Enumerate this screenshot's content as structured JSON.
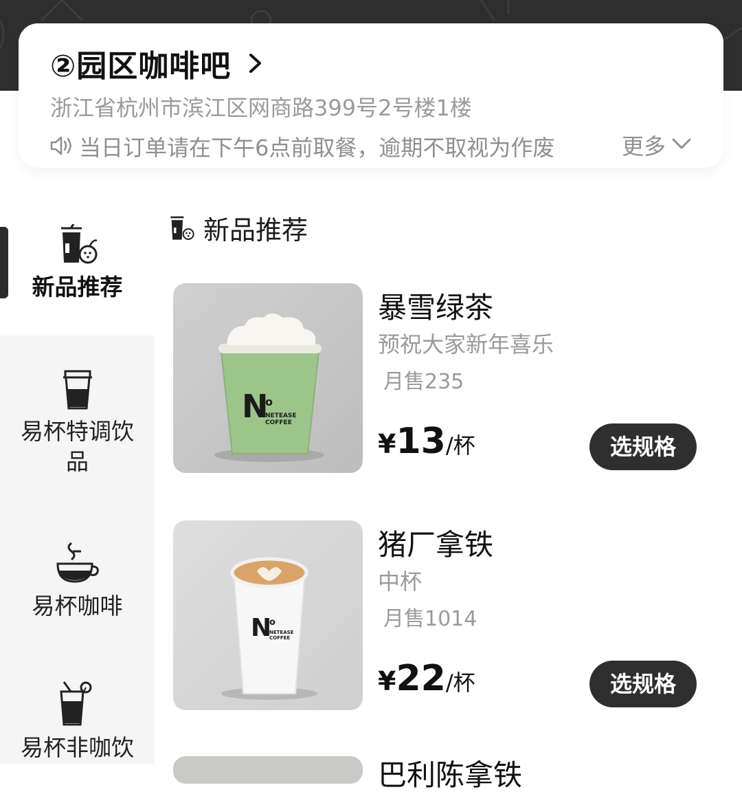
{
  "store": {
    "name": "②园区咖啡吧",
    "address": "浙江省杭州市滨江区网商路399号2号楼1楼",
    "notice": "当日订单请在下午6点前取餐，逾期不取视为作废",
    "more_label": "更多"
  },
  "sidebar": {
    "items": [
      {
        "label": "新品推荐",
        "icon": "new-drink-icon"
      },
      {
        "label": "易杯特调饮品",
        "icon": "takeaway-cup-icon"
      },
      {
        "label": "易杯咖啡",
        "icon": "hot-coffee-icon"
      },
      {
        "label": "易杯非咖饮",
        "icon": "iced-drink-icon"
      }
    ]
  },
  "section": {
    "title": "新品推荐",
    "icon": "new-drink-icon"
  },
  "products": [
    {
      "name": "暴雪绿茶",
      "desc": "预祝大家新年喜乐",
      "sales": "月售235",
      "currency": "¥",
      "price": "13",
      "unit": "/杯",
      "button": "选规格",
      "cup_brand": "NETEASE COFFEE"
    },
    {
      "name": "猪厂拿铁",
      "desc": "中杯",
      "sales": "月售1014",
      "currency": "¥",
      "price": "22",
      "unit": "/杯",
      "button": "选规格",
      "cup_brand": "NETEASE COFFEE"
    }
  ],
  "peek_product": {
    "name": "巴利陈拿铁"
  },
  "colors": {
    "dark": "#2f2f2f",
    "sidebar_bg": "#f5f5f5",
    "muted_text": "#9a9a9a"
  }
}
